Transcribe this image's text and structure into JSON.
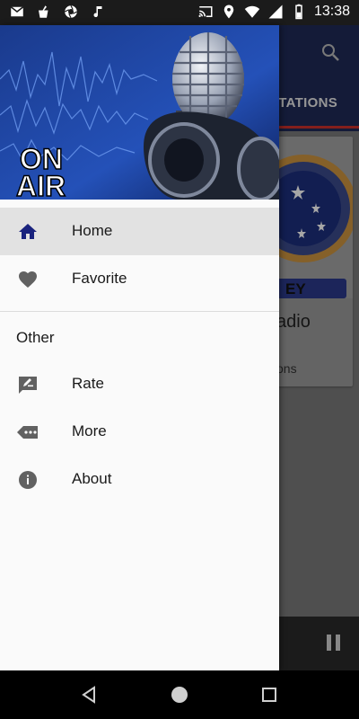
{
  "status_bar": {
    "time": "13:38",
    "left_icons": [
      "mail-icon",
      "cleaner-icon",
      "camera-aperture-icon",
      "music-note-icon"
    ],
    "right_icons": [
      "cast-icon",
      "location-icon",
      "wifi-icon",
      "cellular-signal-icon",
      "battery-icon"
    ]
  },
  "header": {
    "banner_text_line1": "ON",
    "banner_text_line2": "AIR"
  },
  "drawer": {
    "items": [
      {
        "label": "Home",
        "icon": "home-icon",
        "selected": true
      },
      {
        "label": "Favorite",
        "icon": "heart-icon",
        "selected": false
      }
    ],
    "section_title": "Other",
    "other_items": [
      {
        "label": "Rate",
        "icon": "rate-icon"
      },
      {
        "label": "More",
        "icon": "more-tag-icon"
      },
      {
        "label": "About",
        "icon": "info-icon"
      }
    ]
  },
  "background_app": {
    "tab_label": "STATIONS",
    "card_title_partial": "adio",
    "card_subtitle_partial": "ons",
    "logo_text_partial": "EY"
  },
  "colors": {
    "accent": "#1f2a56",
    "tab_indicator": "#c9302c",
    "drawer_bg": "#fafafa",
    "selected_bg": "#e2e2e2",
    "home_icon": "#1a237e",
    "gray_icon": "#616161"
  },
  "system_nav": [
    "back-icon",
    "home-circle-icon",
    "recents-icon"
  ]
}
